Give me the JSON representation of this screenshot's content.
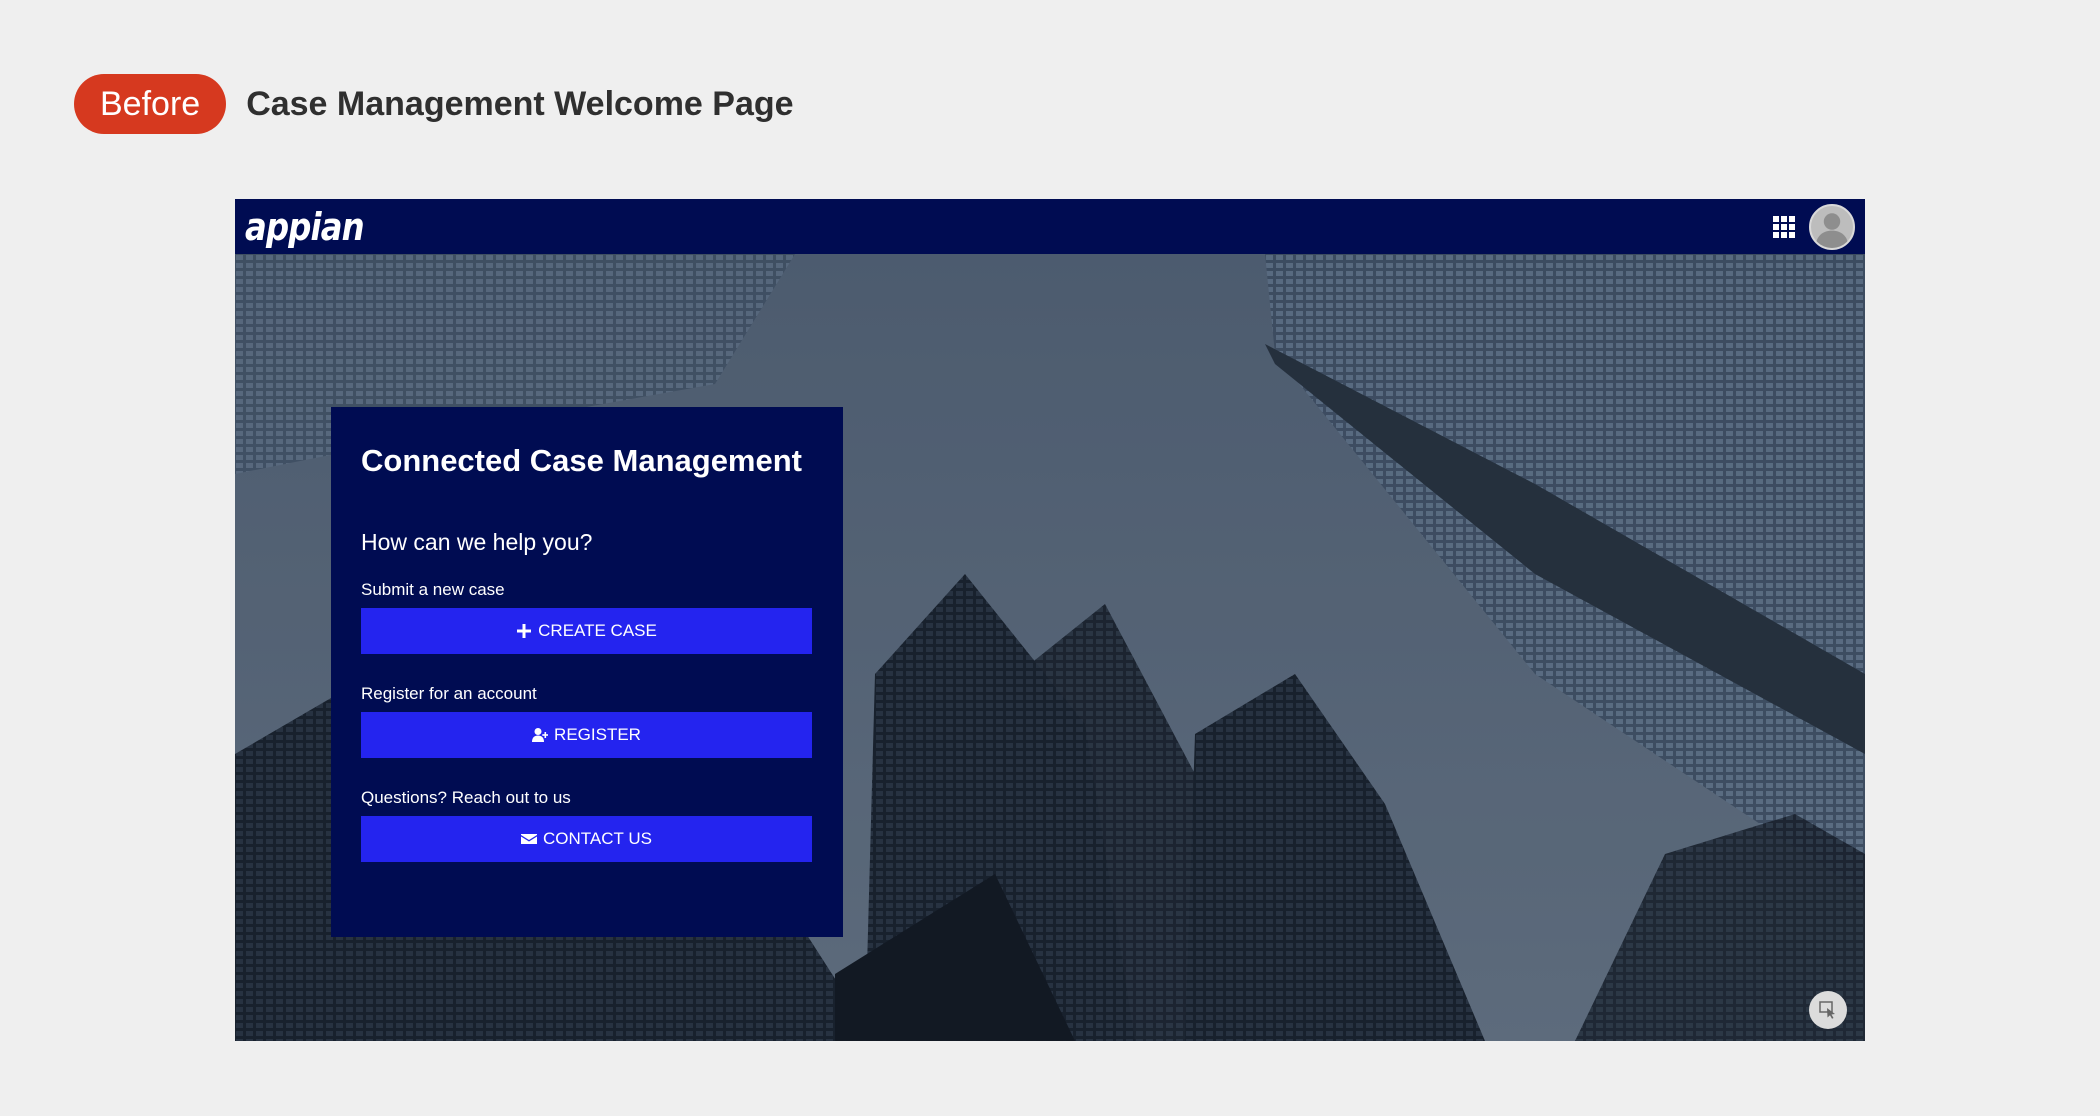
{
  "badge": {
    "label": "Before"
  },
  "page": {
    "title": "Case Management Welcome Page"
  },
  "app": {
    "logo_text": "appian",
    "topbar": {
      "grid_icon": "apps-grid-icon",
      "avatar_icon": "user-avatar-icon"
    },
    "panel": {
      "title": "Connected Case Management",
      "subtitle": "How can we help you?",
      "actions": [
        {
          "label": "Submit a new case",
          "button": "CREATE CASE",
          "icon": "plus-icon"
        },
        {
          "label": "Register for an account",
          "button": "REGISTER",
          "icon": "user-plus-icon"
        },
        {
          "label": "Questions? Reach out to us",
          "button": "CONTACT US",
          "icon": "envelope-icon"
        }
      ]
    },
    "corner_icon": "cursor-select-icon"
  },
  "colors": {
    "badge": "#d6391f",
    "topbar": "#000c52",
    "panel": "#000c52",
    "button": "#2424ef",
    "page_bg": "#efefef"
  }
}
